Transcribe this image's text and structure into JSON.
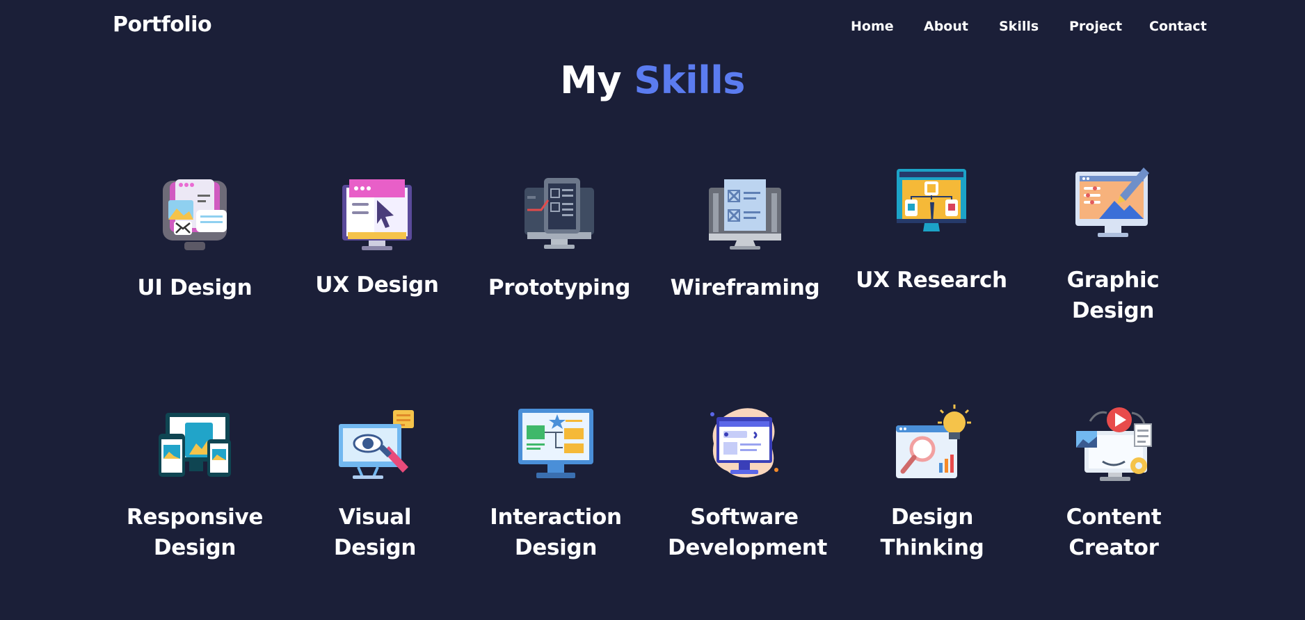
{
  "nav": {
    "logo": "Portfolio",
    "links": [
      "Home",
      "About",
      "Skills",
      "Project",
      "Contact"
    ]
  },
  "heading": {
    "part1": "My",
    "part2": "Skills"
  },
  "colors": {
    "background": "#1b1f38",
    "accent": "#5b7cf0",
    "text": "#ffffff"
  },
  "skills": [
    {
      "label": "UI Design",
      "icon": "ui-design-icon"
    },
    {
      "label": "UX Design",
      "icon": "ux-design-icon"
    },
    {
      "label": "Prototyping",
      "icon": "prototyping-icon"
    },
    {
      "label": "Wireframing",
      "icon": "wireframing-icon"
    },
    {
      "label": "UX Research",
      "icon": "ux-research-icon"
    },
    {
      "label": "Graphic Design",
      "icon": "graphic-design-icon"
    },
    {
      "label": "Responsive Design",
      "icon": "responsive-design-icon"
    },
    {
      "label": "Visual Design",
      "icon": "visual-design-icon"
    },
    {
      "label": "Interaction Design",
      "icon": "interaction-design-icon"
    },
    {
      "label": "Software Development",
      "icon": "software-development-icon"
    },
    {
      "label": "Design Thinking",
      "icon": "design-thinking-icon"
    },
    {
      "label": "Content Creator",
      "icon": "content-creator-icon"
    }
  ]
}
